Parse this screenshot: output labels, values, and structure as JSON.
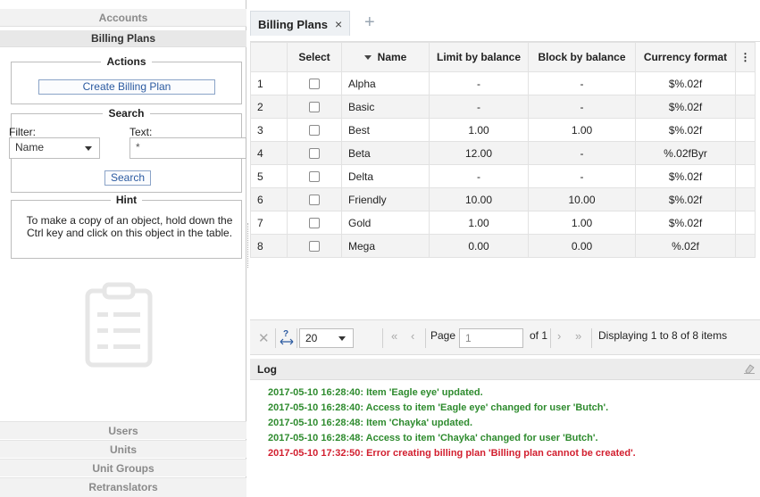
{
  "left": {
    "accordion_top": [
      "Accounts",
      "Billing Plans"
    ],
    "actions": {
      "title": "Actions",
      "create_button": "Create Billing Plan"
    },
    "search": {
      "title": "Search",
      "filter_label": "Filter:",
      "text_label": "Text:",
      "filter_value": "Name",
      "text_value": "*",
      "search_button": "Search"
    },
    "hint": {
      "title": "Hint",
      "text": "To make a copy of an object, hold down the Ctrl key and click on this object in the table."
    },
    "accordion_bottom": [
      "Users",
      "Units",
      "Unit Groups",
      "Retranslators"
    ]
  },
  "tab": {
    "label": "Billing Plans",
    "close": "×",
    "add": "+"
  },
  "table": {
    "columns": [
      "",
      "Select",
      "Name",
      "Limit by balance",
      "Block by balance",
      "Currency format",
      "⋮"
    ],
    "rows": [
      {
        "n": "1",
        "name": "Alpha",
        "limit": "-",
        "block": "-",
        "currency": "$%.02f"
      },
      {
        "n": "2",
        "name": "Basic",
        "limit": "-",
        "block": "-",
        "currency": "$%.02f"
      },
      {
        "n": "3",
        "name": "Best",
        "limit": "1.00",
        "block": "1.00",
        "currency": "$%.02f"
      },
      {
        "n": "4",
        "name": "Beta",
        "limit": "12.00",
        "block": "-",
        "currency": "%.02fByr"
      },
      {
        "n": "5",
        "name": "Delta",
        "limit": "-",
        "block": "-",
        "currency": "$%.02f"
      },
      {
        "n": "6",
        "name": "Friendly",
        "limit": "10.00",
        "block": "10.00",
        "currency": "$%.02f"
      },
      {
        "n": "7",
        "name": "Gold",
        "limit": "1.00",
        "block": "1.00",
        "currency": "$%.02f"
      },
      {
        "n": "8",
        "name": "Mega",
        "limit": "0.00",
        "block": "0.00",
        "currency": "%.02f"
      }
    ]
  },
  "pager": {
    "page_size": "20",
    "page_label": "Page",
    "page_value": "1",
    "of_label": "of 1",
    "display": "Displaying 1 to 8 of 8 items"
  },
  "log": {
    "title": "Log",
    "lines": [
      {
        "type": "ok",
        "text": "2017-05-10 16:28:40: Item 'Eagle eye' updated."
      },
      {
        "type": "ok",
        "text": "2017-05-10 16:28:40: Access to item 'Eagle eye' changed for user 'Butch'."
      },
      {
        "type": "ok",
        "text": "2017-05-10 16:28:48: Item 'Chayka' updated."
      },
      {
        "type": "ok",
        "text": "2017-05-10 16:28:48: Access to item 'Chayka' changed for user 'Butch'."
      },
      {
        "type": "err",
        "text": "2017-05-10 17:32:50: Error creating billing plan 'Billing plan cannot be created'."
      }
    ]
  },
  "colors": {
    "success": "#2e8b2e",
    "error": "#d21f2f",
    "link": "#2b5aa0"
  }
}
